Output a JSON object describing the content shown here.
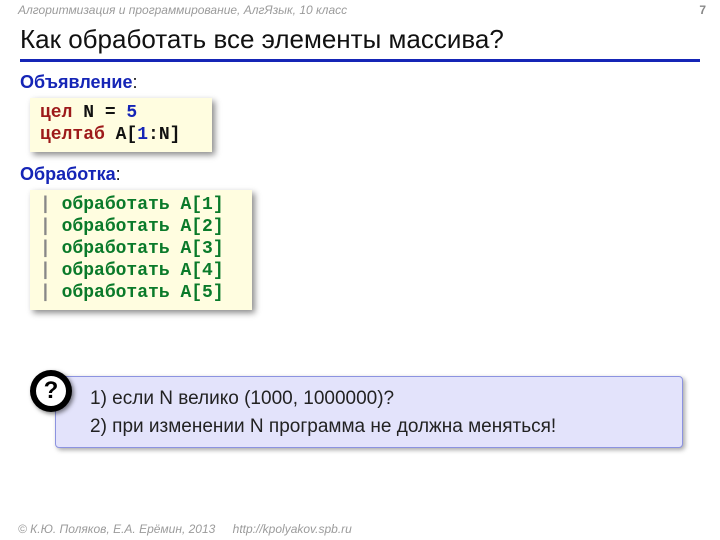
{
  "header": {
    "course": "Алгоритмизация и программирование, АлгЯзык, 10 класс",
    "page_number": "7"
  },
  "title": "Как обработать все элементы массива?",
  "section1": {
    "label": "Объявление",
    "colon": ":"
  },
  "code1": {
    "l1": {
      "kw": "цел",
      "var": " N",
      "eq": " = ",
      "num": "5"
    },
    "l2": {
      "kw": "целтаб",
      "var": " A[",
      "num": "1",
      "rest": ":N]"
    }
  },
  "section2": {
    "label": "Обработка",
    "colon": ":"
  },
  "code2": {
    "bar": "|",
    "word": " обработать ",
    "a1": "A[1]",
    "a2": "A[2]",
    "a3": "A[3]",
    "a4": "A[4]",
    "a5": "A[5]"
  },
  "question": {
    "mark": "?",
    "line1": "1) если N велико (1000, 1000000)?",
    "line2": "2) при изменении N программа не должна меняться!"
  },
  "footer": {
    "copyright": "© К.Ю. Поляков, Е.А. Ерёмин, 2013",
    "url": "http://kpolyakov.spb.ru"
  }
}
